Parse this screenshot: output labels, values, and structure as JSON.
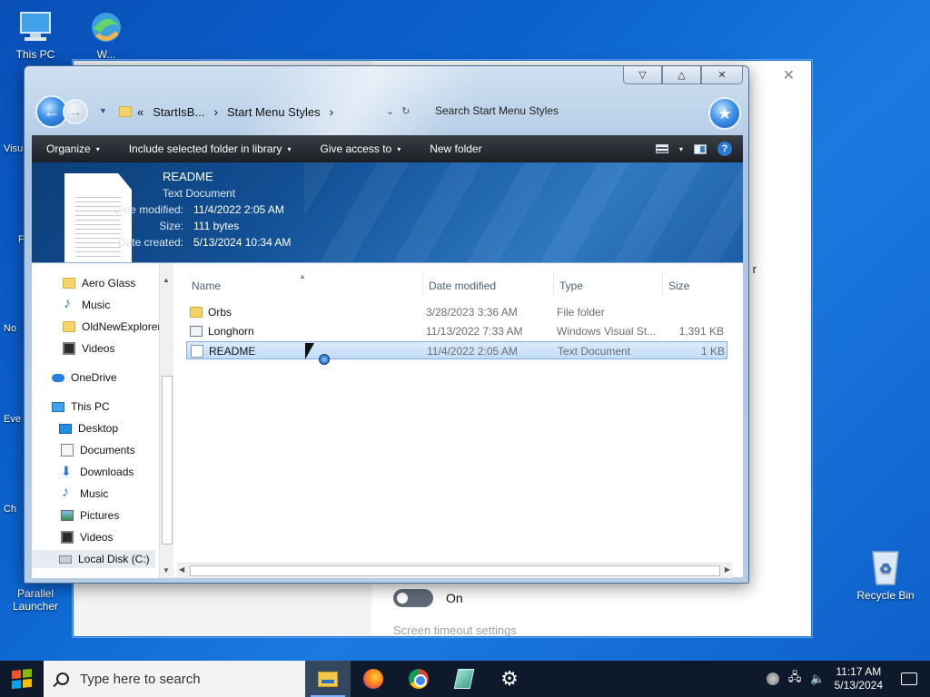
{
  "desktop": {
    "icons": [
      {
        "label": "This PC",
        "icon": "this-pc-icon"
      },
      {
        "label": "W...",
        "icon": "edge-icon"
      },
      {
        "label": "Parallel Launcher",
        "icon": "parallel-launcher-icon"
      },
      {
        "label": "Recycle Bin",
        "icon": "recycle-bin-icon"
      }
    ],
    "left_fragments": [
      "Visu",
      "F",
      "No",
      "Eve",
      "Ch"
    ]
  },
  "background_window": {
    "close_glyph": "✕",
    "right_fragment": "r",
    "toggle_label": "On",
    "timeout_link": "Screen timeout settings"
  },
  "explorer": {
    "caption": {
      "minimize": "▽",
      "maximize": "△",
      "close": "✕"
    },
    "address": {
      "overflow": "«",
      "segments": [
        "StartIsB...",
        "Start Menu Styles"
      ],
      "separator": "›"
    },
    "search_placeholder": "Search Start Menu Styles",
    "toolbar": {
      "organize": "Organize",
      "include_library": "Include selected folder in library",
      "give_access": "Give access to",
      "new_folder": "New folder",
      "caret": "▾",
      "help": "?"
    },
    "details": {
      "name": "README",
      "type": "Text Document",
      "fields": [
        {
          "key": "Date modified:",
          "value": "11/4/2022 2:05 AM"
        },
        {
          "key": "Size:",
          "value": "111 bytes"
        },
        {
          "key": "Date created:",
          "value": "5/13/2024 10:34 AM"
        }
      ]
    },
    "nav_pane": [
      {
        "label": "Aero Glass",
        "icon": "folder-icon"
      },
      {
        "label": "Music",
        "icon": "music-icon"
      },
      {
        "label": "OldNewExplorer",
        "icon": "folder-icon"
      },
      {
        "label": "Videos",
        "icon": "videos-icon"
      },
      {
        "label": "OneDrive",
        "icon": "onedrive-icon"
      },
      {
        "label": "This PC",
        "icon": "this-pc-icon"
      },
      {
        "label": "Desktop",
        "icon": "desktop-icon"
      },
      {
        "label": "Documents",
        "icon": "documents-icon"
      },
      {
        "label": "Downloads",
        "icon": "downloads-icon"
      },
      {
        "label": "Music",
        "icon": "music-icon"
      },
      {
        "label": "Pictures",
        "icon": "pictures-icon"
      },
      {
        "label": "Videos",
        "icon": "videos-icon"
      },
      {
        "label": "Local Disk (C:)",
        "icon": "local-disk-icon"
      }
    ],
    "columns": {
      "name": "Name",
      "date": "Date modified",
      "type": "Type",
      "size": "Size"
    },
    "files": [
      {
        "name": "Orbs",
        "date": "3/28/2023 3:36 AM",
        "type": "File folder",
        "size": "",
        "icon": "folder-icon"
      },
      {
        "name": "Longhorn",
        "date": "11/13/2022 7:33 AM",
        "type": "Windows Visual St...",
        "size": "1,391 KB",
        "icon": "vs-project-icon"
      },
      {
        "name": "README",
        "date": "11/4/2022 2:05 AM",
        "type": "Text Document",
        "size": "1 KB",
        "icon": "text-file-icon",
        "selected": true
      }
    ]
  },
  "taskbar": {
    "search_placeholder": "Type here to search",
    "apps": [
      "file-explorer-icon",
      "firefox-icon",
      "chrome-icon",
      "glass-app-icon",
      "settings-icon"
    ],
    "clock_time": "11:17 AM",
    "clock_date": "5/13/2024"
  }
}
